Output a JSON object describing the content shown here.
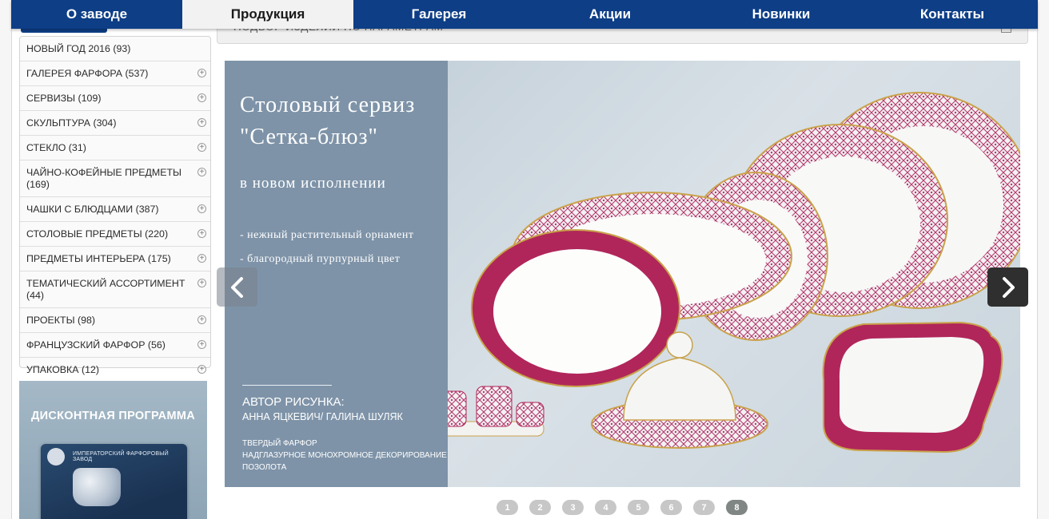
{
  "nav": {
    "items": [
      {
        "label": "О заводе"
      },
      {
        "label": "Продукция"
      },
      {
        "label": "Галерея"
      },
      {
        "label": "Акции"
      },
      {
        "label": "Новинки"
      },
      {
        "label": "Контакты"
      }
    ],
    "active_index": 1
  },
  "filter": {
    "label": "ПОДБОР ИЗДЕЛИЙ ПО ПАРАМЕТРАМ",
    "toggle_icon": "plus-box-icon"
  },
  "categories": [
    {
      "label": "НОВЫЙ ГОД 2016 (93)",
      "expandable": false
    },
    {
      "label": "ГАЛЕРЕЯ ФАРФОРА (537)",
      "expandable": true
    },
    {
      "label": "СЕРВИЗЫ (109)",
      "expandable": true
    },
    {
      "label": "СКУЛЬПТУРА (304)",
      "expandable": true
    },
    {
      "label": "СТЕКЛО (31)",
      "expandable": true
    },
    {
      "label": "ЧАЙНО-КОФЕЙНЫЕ ПРЕДМЕТЫ (169)",
      "expandable": true
    },
    {
      "label": "ЧАШКИ С БЛЮДЦАМИ (387)",
      "expandable": true
    },
    {
      "label": "СТОЛОВЫЕ ПРЕДМЕТЫ (220)",
      "expandable": true
    },
    {
      "label": "ПРЕДМЕТЫ ИНТЕРЬЕРА (175)",
      "expandable": true
    },
    {
      "label": "ТЕМАТИЧЕСКИЙ АССОРТИМЕНТ (44)",
      "expandable": true
    },
    {
      "label": "ПРОЕКТЫ (98)",
      "expandable": true
    },
    {
      "label": "ФРАНЦУЗСКИЙ ФАРФОР (56)",
      "expandable": true
    },
    {
      "label": "УПАКОВКА (12)",
      "expandable": true
    }
  ],
  "discount": {
    "title": "ДИСКОНТНАЯ ПРОГРАММА",
    "card_text": "ИМПЕРАТОРСКИЙ ФАРФОРОВЫЙ ЗАВОД"
  },
  "slide": {
    "title_line1": "Столовый сервиз",
    "title_line2": "\"Сетка-блюз\"",
    "subtitle": "в новом исполнении",
    "feature1": "- нежный растительный орнамент",
    "feature2": "- благородный пурпурный цвет",
    "author_heading": "АВТОР РИСУНКА:",
    "author_names": "АННА ЯЦКЕВИЧ/ ГАЛИНА ШУЛЯК",
    "material1": "ТВЕРДЫЙ ФАРФОР",
    "material2": "НАДГЛАЗУРНОЕ МОНОХРОМНОЕ ДЕКОРИРОВАНИЕ",
    "material3": "ПОЗОЛОТА"
  },
  "pagination": {
    "pages": [
      "1",
      "2",
      "3",
      "4",
      "5",
      "6",
      "7",
      "8"
    ],
    "active_index": 7
  },
  "colors": {
    "nav_bg": "#0d3e86",
    "accent_pink": "#b0265a",
    "gold": "#c8a24a"
  }
}
